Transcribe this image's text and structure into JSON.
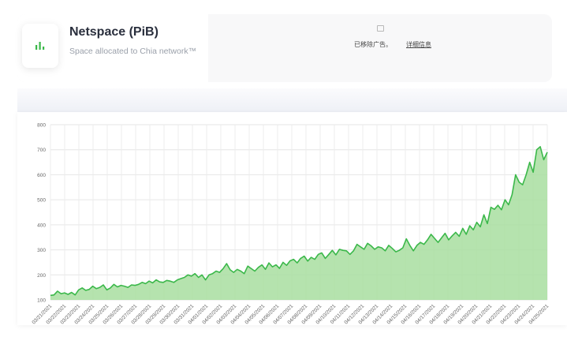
{
  "header": {
    "title": "Netspace (PiB)",
    "subtitle": "Space allocated to Chia network™",
    "icon": "bar-chart-icon",
    "accent_color": "#3bb84a"
  },
  "ad": {
    "notice": "已移除广告。",
    "link": "详细信息",
    "icon": "ad-info-icon"
  },
  "chart_data": {
    "type": "area",
    "ylim": [
      100,
      800
    ],
    "yticks": [
      100,
      200,
      300,
      400,
      500,
      600,
      700,
      800
    ],
    "grid": true,
    "line_color": "#3bb84a",
    "fill_color": "#a8dea0",
    "x_tick_labels": [
      "03/21/2021",
      "03/22/2021",
      "03/23/2021",
      "03/24/2021",
      "03/25/2021",
      "03/26/2021",
      "03/27/2021",
      "03/28/2021",
      "03/29/2021",
      "03/30/2021",
      "03/31/2021",
      "04/01/2021",
      "04/02/2021",
      "04/03/2021",
      "04/04/2021",
      "04/05/2021",
      "04/06/2021",
      "04/07/2021",
      "04/08/2021",
      "04/09/2021",
      "04/10/2021",
      "04/11/2021",
      "04/12/2021",
      "04/13/2021",
      "04/14/2021",
      "04/15/2021",
      "04/16/2021",
      "04/17/2021",
      "04/18/2021",
      "04/19/2021",
      "04/20/2021",
      "04/21/2021",
      "04/22/2021",
      "04/23/2021",
      "04/24/2021",
      "04/25/2021"
    ],
    "y": [
      118,
      120,
      135,
      125,
      128,
      122,
      130,
      120,
      140,
      148,
      138,
      142,
      155,
      145,
      150,
      160,
      140,
      148,
      162,
      152,
      158,
      155,
      150,
      160,
      158,
      162,
      170,
      165,
      175,
      168,
      180,
      172,
      170,
      178,
      175,
      170,
      180,
      185,
      190,
      200,
      195,
      205,
      190,
      200,
      180,
      200,
      205,
      215,
      210,
      225,
      245,
      220,
      210,
      222,
      215,
      205,
      235,
      225,
      215,
      230,
      240,
      222,
      248,
      232,
      240,
      226,
      250,
      238,
      256,
      262,
      248,
      266,
      275,
      255,
      270,
      262,
      282,
      288,
      266,
      282,
      298,
      280,
      302,
      298,
      296,
      282,
      296,
      322,
      312,
      302,
      326,
      316,
      302,
      312,
      308,
      296,
      318,
      306,
      292,
      298,
      308,
      344,
      318,
      296,
      318,
      330,
      322,
      340,
      362,
      346,
      330,
      348,
      366,
      340,
      356,
      370,
      354,
      386,
      362,
      396,
      380,
      410,
      392,
      440,
      405,
      470,
      462,
      478,
      460,
      500,
      480,
      520,
      600,
      570,
      560,
      600,
      650,
      610,
      700,
      712,
      660,
      690
    ]
  }
}
